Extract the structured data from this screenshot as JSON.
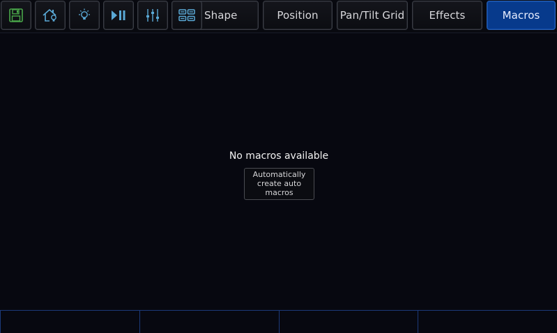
{
  "toolbar": {
    "icons": [
      {
        "name": "save-icon",
        "color": "#4aa84a"
      },
      {
        "name": "home-light-icon",
        "color": "#5aa9d6"
      },
      {
        "name": "bulb-icon",
        "color": "#5aa9d6"
      },
      {
        "name": "play-pause-icon",
        "color": "#5aa9d6"
      },
      {
        "name": "faders-icon",
        "color": "#5aa9d6"
      },
      {
        "name": "grid-icon",
        "color": "#5aa9d6"
      }
    ],
    "tabs": [
      {
        "label": "Shape",
        "active": false
      },
      {
        "label": "Position",
        "active": false
      },
      {
        "label": "Pan/Tilt Grid",
        "active": false
      },
      {
        "label": "Effects",
        "active": false
      },
      {
        "label": "Macros",
        "active": true
      }
    ],
    "active_color": "#073a8c"
  },
  "main": {
    "empty_message": "No macros available",
    "auto_button_label": "Automatically create auto macros"
  },
  "bottom_bar": {
    "cells": [
      "",
      "",
      "",
      ""
    ]
  }
}
